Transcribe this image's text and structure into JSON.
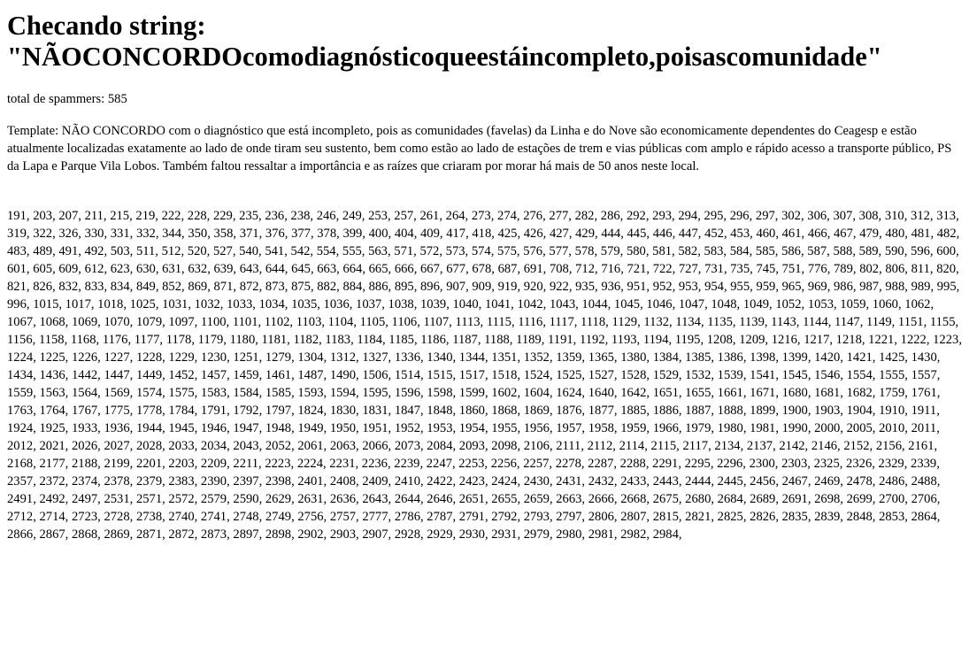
{
  "header": {
    "title_prefix": "Checando string:",
    "title_string": "\"NÃOCONCORDOcomodiagnósticoqueestáincompleto,poisascomunidade\""
  },
  "total": {
    "label": "total de spammers: 585"
  },
  "template": {
    "text": "Template: NÃO CONCORDO com o diagnóstico que está incompleto, pois as comunidades (favelas) da Linha e do Nove são economicamente dependentes do Ceagesp e estão atualmente localizadas exatamente ao lado de onde tiram seu sustento, bem como estão ao lado de estações de trem e vias públicas com amplo e rápido acesso a transporte público, PS da Lapa e Parque Vila Lobos. Também faltou ressaltar a importância e as raízes que criaram por morar há mais de 50 anos neste local."
  },
  "ids": {
    "text": "191, 203, 207, 211, 215, 219, 222, 228, 229, 235, 236, 238, 246, 249, 253, 257, 261, 264, 273, 274, 276, 277, 282, 286, 292, 293, 294, 295, 296, 297, 302, 306, 307, 308, 310, 312, 313, 319, 322, 326, 330, 331, 332, 344, 350, 358, 371, 376, 377, 378, 399, 400, 404, 409, 417, 418, 425, 426, 427, 429, 444, 445, 446, 447, 452, 453, 460, 461, 466, 467, 479, 480, 481, 482, 483, 489, 491, 492, 503, 511, 512, 520, 527, 540, 541, 542, 554, 555, 563, 571, 572, 573, 574, 575, 576, 577, 578, 579, 580, 581, 582, 583, 584, 585, 586, 587, 588, 589, 590, 596, 600, 601, 605, 609, 612, 623, 630, 631, 632, 639, 643, 644, 645, 663, 664, 665, 666, 667, 677, 678, 687, 691, 708, 712, 716, 721, 722, 727, 731, 735, 745, 751, 776, 789, 802, 806, 811, 820, 821, 826, 832, 833, 834, 849, 852, 869, 871, 872, 873, 875, 882, 884, 886, 895, 896, 907, 909, 919, 920, 922, 935, 936, 951, 952, 953, 954, 955, 959, 965, 969, 986, 987, 988, 989, 995, 996, 1015, 1017, 1018, 1025, 1031, 1032, 1033, 1034, 1035, 1036, 1037, 1038, 1039, 1040, 1041, 1042, 1043, 1044, 1045, 1046, 1047, 1048, 1049, 1052, 1053, 1059, 1060, 1062, 1067, 1068, 1069, 1070, 1079, 1097, 1100, 1101, 1102, 1103, 1104, 1105, 1106, 1107, 1113, 1115, 1116, 1117, 1118, 1129, 1132, 1134, 1135, 1139, 1143, 1144, 1147, 1149, 1151, 1155, 1156, 1158, 1168, 1176, 1177, 1178, 1179, 1180, 1181, 1182, 1183, 1184, 1185, 1186, 1187, 1188, 1189, 1191, 1192, 1193, 1194, 1195, 1208, 1209, 1216, 1217, 1218, 1221, 1222, 1223, 1224, 1225, 1226, 1227, 1228, 1229, 1230, 1251, 1279, 1304, 1312, 1327, 1336, 1340, 1344, 1351, 1352, 1359, 1365, 1380, 1384, 1385, 1386, 1398, 1399, 1420, 1421, 1425, 1430, 1434, 1436, 1442, 1447, 1449, 1452, 1457, 1459, 1461, 1487, 1490, 1506, 1514, 1515, 1517, 1518, 1524, 1525, 1527, 1528, 1529, 1532, 1539, 1541, 1545, 1546, 1554, 1555, 1557, 1559, 1563, 1564, 1569, 1574, 1575, 1583, 1584, 1585, 1593, 1594, 1595, 1596, 1598, 1599, 1602, 1604, 1624, 1640, 1642, 1651, 1655, 1661, 1671, 1680, 1681, 1682, 1759, 1761, 1763, 1764, 1767, 1775, 1778, 1784, 1791, 1792, 1797, 1824, 1830, 1831, 1847, 1848, 1860, 1868, 1869, 1876, 1877, 1885, 1886, 1887, 1888, 1899, 1900, 1903, 1904, 1910, 1911, 1924, 1925, 1933, 1936, 1944, 1945, 1946, 1947, 1948, 1949, 1950, 1951, 1952, 1953, 1954, 1955, 1956, 1957, 1958, 1959, 1966, 1979, 1980, 1981, 1990, 2000, 2005, 2010, 2011, 2012, 2021, 2026, 2027, 2028, 2033, 2034, 2043, 2052, 2061, 2063, 2066, 2073, 2084, 2093, 2098, 2106, 2111, 2112, 2114, 2115, 2117, 2134, 2137, 2142, 2146, 2152, 2156, 2161, 2168, 2177, 2188, 2199, 2201, 2203, 2209, 2211, 2223, 2224, 2231, 2236, 2239, 2247, 2253, 2256, 2257, 2278, 2287, 2288, 2291, 2295, 2296, 2300, 2303, 2325, 2326, 2329, 2339, 2357, 2372, 2374, 2378, 2379, 2383, 2390, 2397, 2398, 2401, 2408, 2409, 2410, 2422, 2423, 2424, 2430, 2431, 2432, 2433, 2443, 2444, 2445, 2456, 2467, 2469, 2478, 2486, 2488, 2491, 2492, 2497, 2531, 2571, 2572, 2579, 2590, 2629, 2631, 2636, 2643, 2644, 2646, 2651, 2655, 2659, 2663, 2666, 2668, 2675, 2680, 2684, 2689, 2691, 2698, 2699, 2700, 2706, 2712, 2714, 2723, 2728, 2738, 2740, 2741, 2748, 2749, 2756, 2757, 2777, 2786, 2787, 2791, 2792, 2793, 2797, 2806, 2807, 2815, 2821, 2825, 2826, 2835, 2839, 2848, 2853, 2864, 2866, 2867, 2868, 2869, 2871, 2872, 2873, 2897, 2898, 2902, 2903, 2907, 2928, 2929, 2930, 2931, 2979, 2980, 2981, 2982, 2984,"
  }
}
